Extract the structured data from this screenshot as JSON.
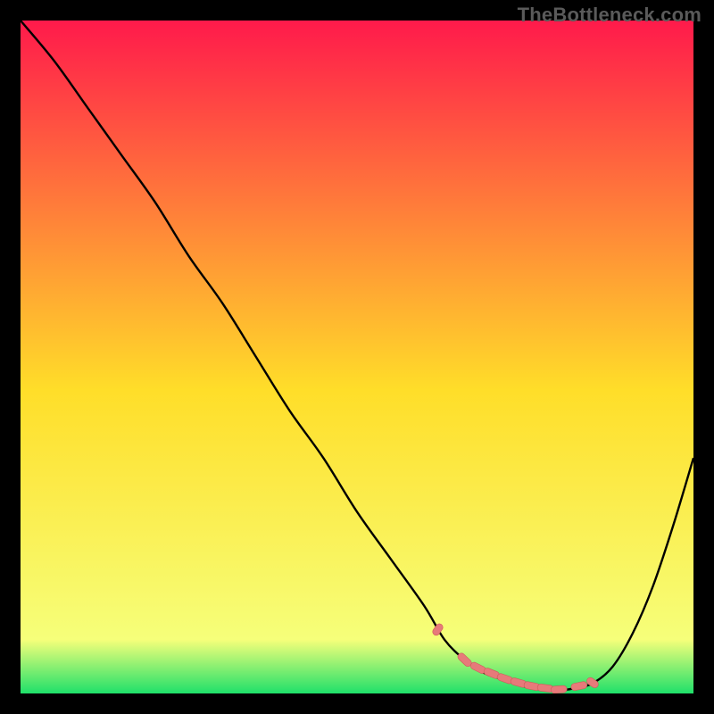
{
  "watermark": "TheBottleneck.com",
  "colors": {
    "grad_top": "#ff1a4b",
    "grad_mid": "#ffde29",
    "grad_bottom": "#1fe06a",
    "curve_stroke": "#000000",
    "marker_fill": "#e77a7a",
    "marker_stroke": "#cf5a5a",
    "background": "#000000"
  },
  "chart_data": {
    "type": "line",
    "title": "",
    "xlabel": "",
    "ylabel": "",
    "xlim": [
      0,
      100
    ],
    "ylim": [
      0,
      100
    ],
    "x": [
      0,
      5,
      10,
      15,
      20,
      25,
      30,
      35,
      40,
      45,
      50,
      55,
      60,
      63,
      66,
      69,
      72,
      75,
      78,
      80,
      82,
      85,
      88,
      91,
      94,
      97,
      100
    ],
    "values": [
      100,
      94,
      87,
      80,
      73,
      65,
      58,
      50,
      42,
      35,
      27,
      20,
      13,
      8,
      5,
      3,
      2,
      1,
      0.7,
      0.5,
      0.7,
      1.5,
      4,
      9,
      16,
      25,
      35
    ],
    "markers_x": [
      62,
      66,
      68,
      70,
      72,
      74,
      76,
      78,
      80,
      83,
      85
    ],
    "markers_y": [
      9.5,
      5,
      3.8,
      3,
      2.2,
      1.6,
      1.1,
      0.8,
      0.6,
      1.1,
      1.6
    ]
  }
}
